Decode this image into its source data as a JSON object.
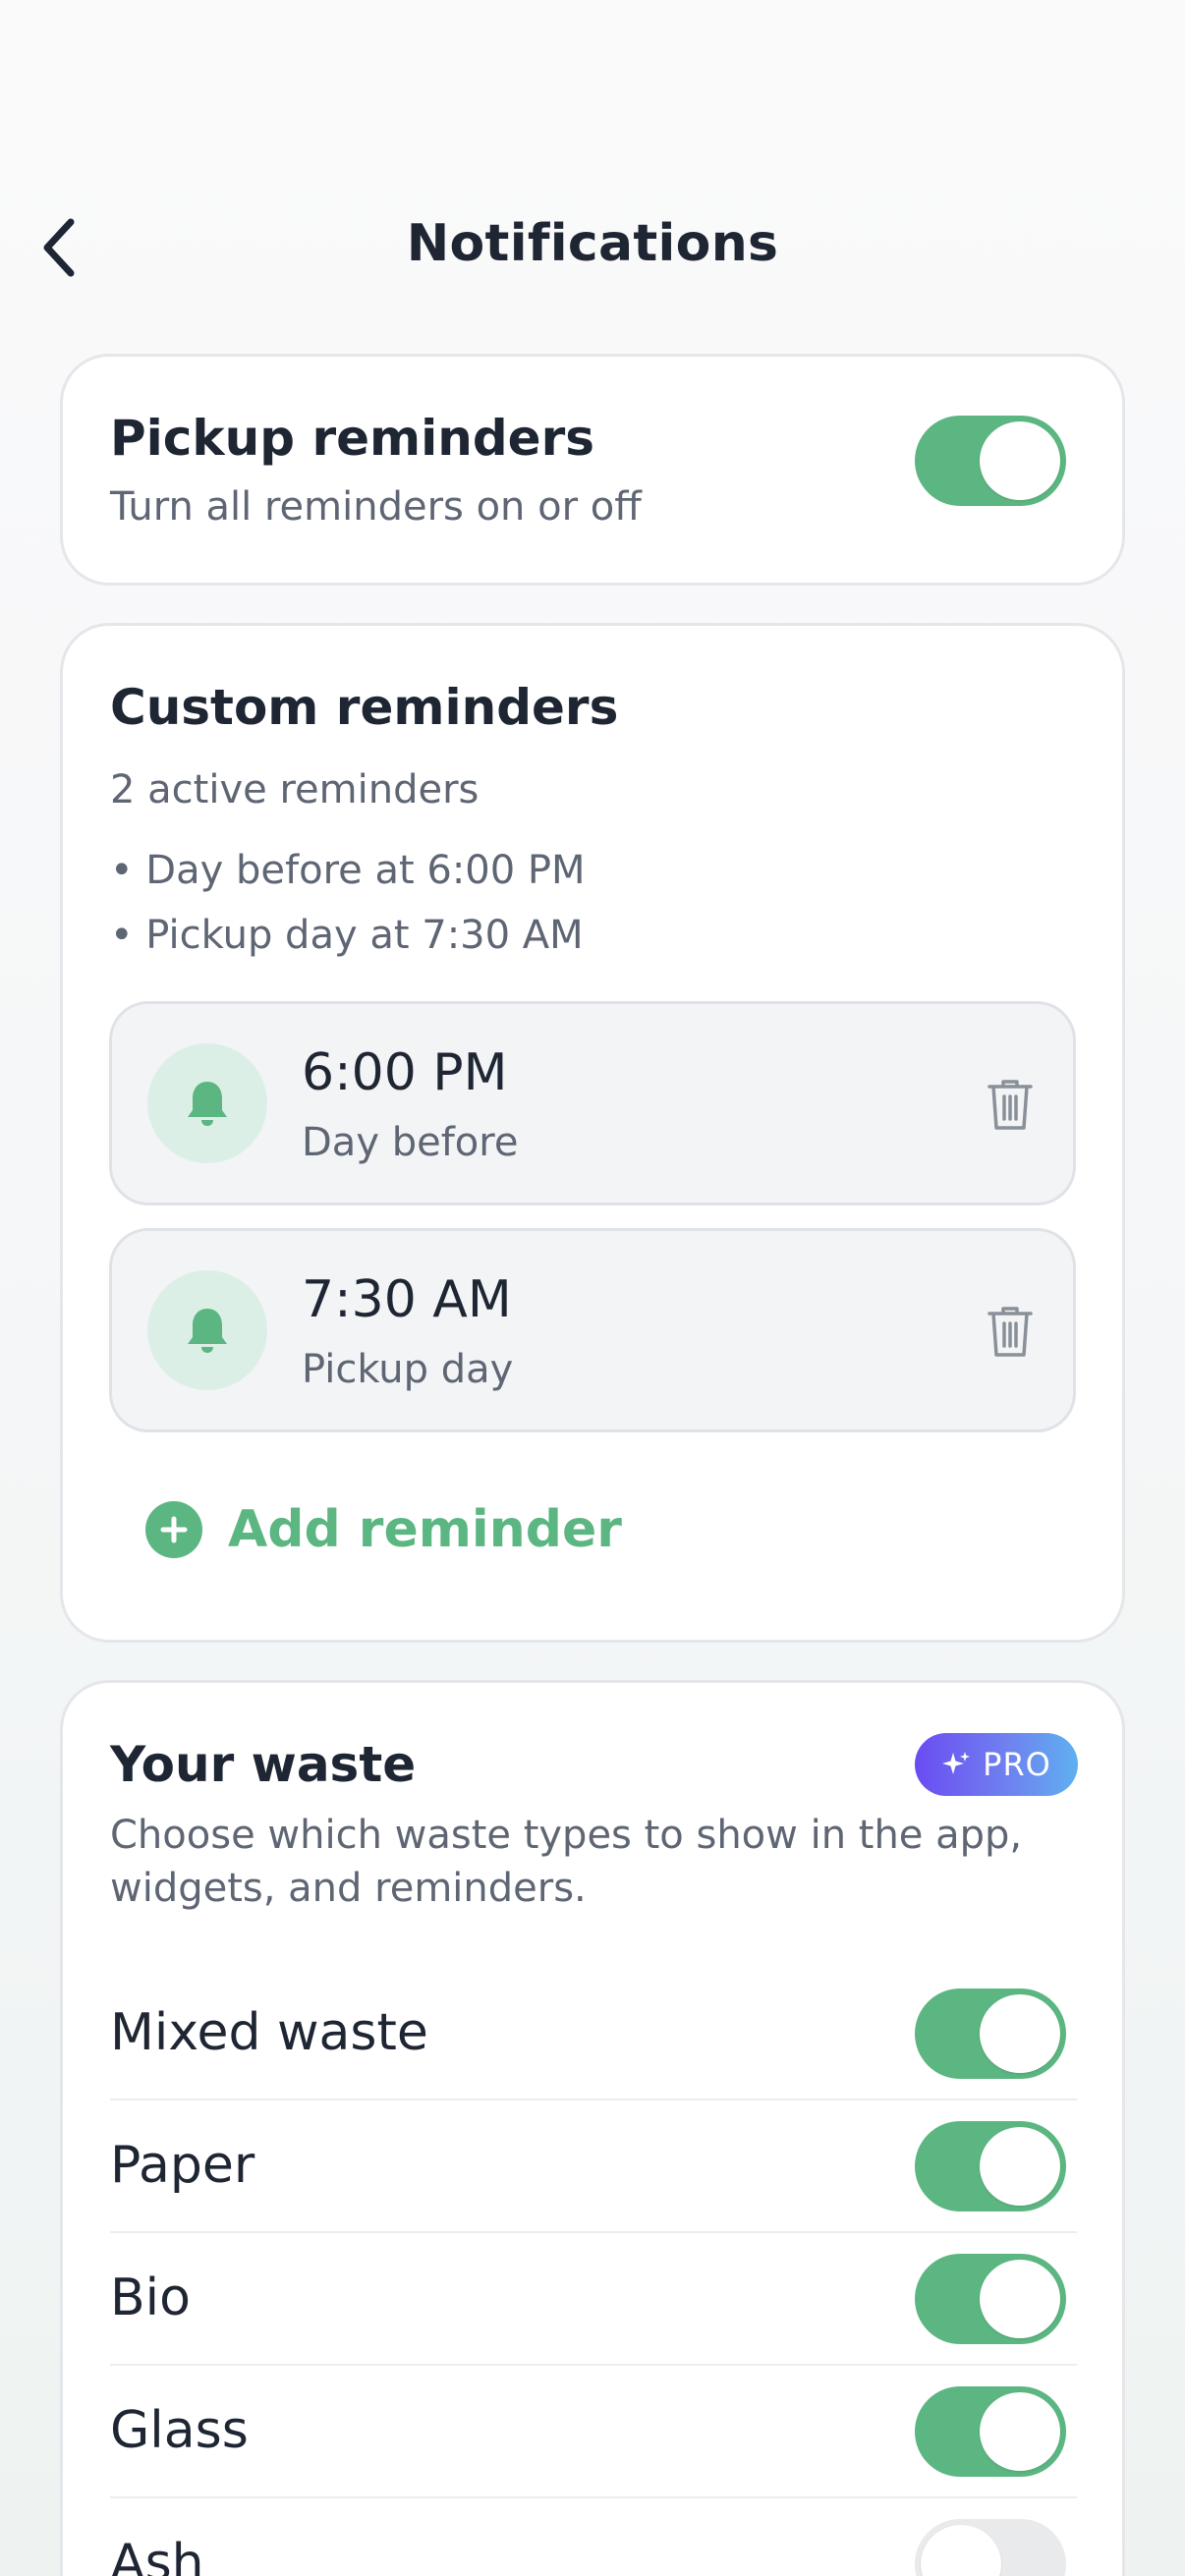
{
  "header": {
    "title": "Notifications"
  },
  "pickup": {
    "title": "Pickup reminders",
    "subtitle": "Turn all reminders on or off",
    "enabled": true
  },
  "custom": {
    "title": "Custom reminders",
    "count_text": "2 active reminders",
    "bullets": [
      "• Day before at 6:00 PM",
      "• Pickup day at 7:30 AM"
    ],
    "reminders": [
      {
        "time": "6:00 PM",
        "label": "Day before"
      },
      {
        "time": "7:30 AM",
        "label": "Pickup day"
      }
    ],
    "add_label": "Add reminder"
  },
  "waste": {
    "title": "Your waste",
    "badge": "PRO",
    "description": "Choose which waste types to show in the app, widgets, and reminders.",
    "types": [
      {
        "name": "Mixed waste",
        "enabled": true
      },
      {
        "name": "Paper",
        "enabled": true
      },
      {
        "name": "Bio",
        "enabled": true
      },
      {
        "name": "Glass",
        "enabled": true
      },
      {
        "name": "Ash",
        "enabled": false
      }
    ]
  },
  "colors": {
    "accent": "#5cb681",
    "badge_start": "#6a4cf2",
    "badge_end": "#5fb0f0"
  },
  "icons": [
    "back-arrow-icon",
    "bell-icon",
    "trash-icon",
    "plus-circle-icon",
    "sparkle-icon"
  ]
}
